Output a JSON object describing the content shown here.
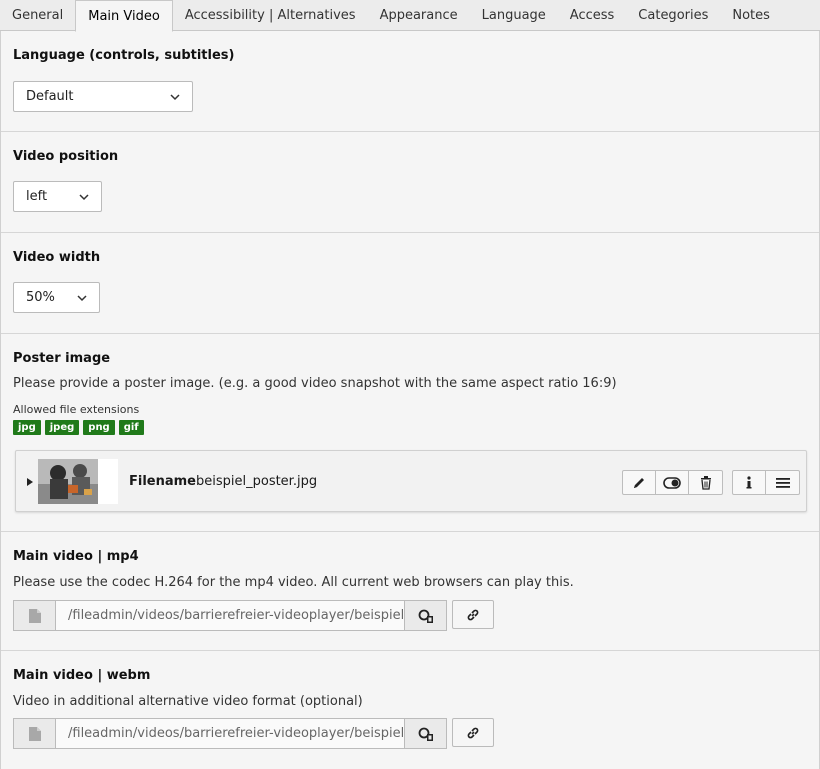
{
  "tabs": [
    {
      "label": "General"
    },
    {
      "label": "Main Video"
    },
    {
      "label": "Accessibility | Alternatives"
    },
    {
      "label": "Appearance"
    },
    {
      "label": "Language"
    },
    {
      "label": "Access"
    },
    {
      "label": "Categories"
    },
    {
      "label": "Notes"
    }
  ],
  "active_tab": "Main Video",
  "language": {
    "label": "Language (controls, subtitles)",
    "value": "Default"
  },
  "video_position": {
    "label": "Video position",
    "value": "left"
  },
  "video_width": {
    "label": "Video width",
    "value": "50%"
  },
  "poster": {
    "label": "Poster image",
    "description": "Please provide a poster image. (e.g. a good video snapshot with the same aspect ratio 16:9)",
    "allowed_label": "Allowed file extensions",
    "extensions": [
      "jpg",
      "jpeg",
      "png",
      "gif"
    ],
    "file": {
      "filename_label": "Filename",
      "filename": "beispiel_poster.jpg"
    }
  },
  "mp4": {
    "label": "Main video | mp4",
    "description": "Please use the codec H.264 for the mp4 video. All current web browsers can play this.",
    "path": "/fileadmin/videos/barrierefreier-videoplayer/beispiel"
  },
  "webm": {
    "label": "Main video | webm",
    "description": "Video in additional alternative video format (optional)",
    "path": "/fileadmin/videos/barrierefreier-videoplayer/beispiel"
  },
  "colors": {
    "badge": "#207a1a",
    "background": "#f5f5f5"
  }
}
